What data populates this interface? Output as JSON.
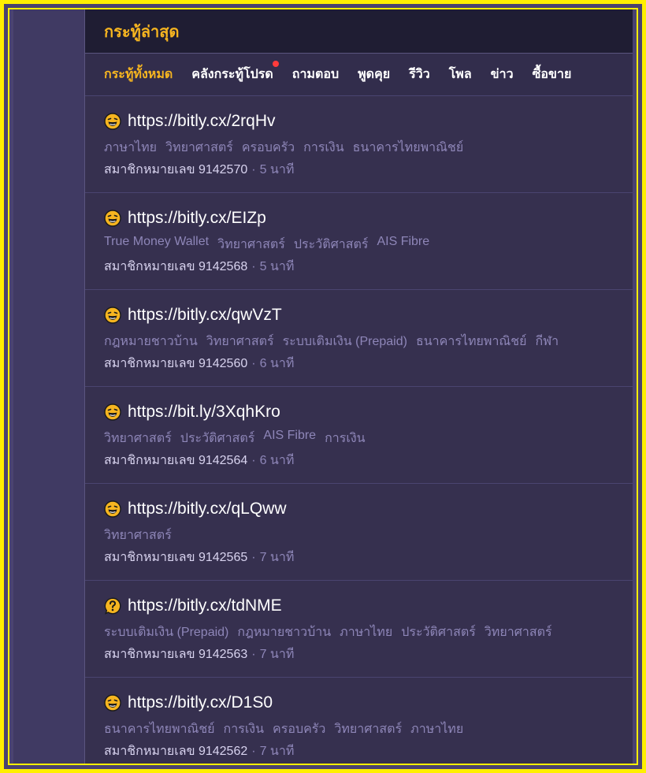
{
  "header": {
    "title": "กระทู้ล่าสุด"
  },
  "tabs": [
    {
      "label": "กระทู้ทั้งหมด",
      "active": true,
      "dot": false
    },
    {
      "label": "คลังกระทู้โปรด",
      "active": false,
      "dot": true
    },
    {
      "label": "ถามตอบ",
      "active": false,
      "dot": false
    },
    {
      "label": "พูดคุย",
      "active": false,
      "dot": false
    },
    {
      "label": "รีวิว",
      "active": false,
      "dot": false
    },
    {
      "label": "โพล",
      "active": false,
      "dot": false
    },
    {
      "label": "ข่าว",
      "active": false,
      "dot": false
    },
    {
      "label": "ซื้อขาย",
      "active": false,
      "dot": false
    }
  ],
  "colors": {
    "accent": "#f6b520",
    "notification_dot": "#ff3b3b",
    "frame": "#ffef00"
  },
  "topics": [
    {
      "icon": "laughing-face-icon",
      "title": "https://bitly.cx/2rqHv",
      "tags": [
        "ภาษาไทย",
        "วิทยาศาสตร์",
        "ครอบครัว",
        "การเงิน",
        "ธนาคารไทยพาณิชย์"
      ],
      "author": "สมาชิกหมายเลข 9142570",
      "time": "5 นาที"
    },
    {
      "icon": "laughing-face-icon",
      "title": "https://bitly.cx/EIZp",
      "tags": [
        "True Money Wallet",
        "วิทยาศาสตร์",
        "ประวัติศาสตร์",
        "AIS Fibre"
      ],
      "author": "สมาชิกหมายเลข 9142568",
      "time": "5 นาที"
    },
    {
      "icon": "laughing-face-icon",
      "title": "https://bitly.cx/qwVzT",
      "tags": [
        "กฎหมายชาวบ้าน",
        "วิทยาศาสตร์",
        "ระบบเติมเงิน (Prepaid)",
        "ธนาคารไทยพาณิชย์",
        "กีฬา"
      ],
      "author": "สมาชิกหมายเลข 9142560",
      "time": "6 นาที"
    },
    {
      "icon": "laughing-face-icon",
      "title": "https://bit.ly/3XqhKro",
      "tags": [
        "วิทยาศาสตร์",
        "ประวัติศาสตร์",
        "AIS Fibre",
        "การเงิน"
      ],
      "author": "สมาชิกหมายเลข 9142564",
      "time": "6 นาที"
    },
    {
      "icon": "laughing-face-icon",
      "title": "https://bitly.cx/qLQww",
      "tags": [
        "วิทยาศาสตร์"
      ],
      "author": "สมาชิกหมายเลข 9142565",
      "time": "7 นาที"
    },
    {
      "icon": "question-bubble-icon",
      "title": "https://bitly.cx/tdNME",
      "tags": [
        "ระบบเติมเงิน (Prepaid)",
        "กฎหมายชาวบ้าน",
        "ภาษาไทย",
        "ประวัติศาสตร์",
        "วิทยาศาสตร์"
      ],
      "author": "สมาชิกหมายเลข 9142563",
      "time": "7 นาที"
    },
    {
      "icon": "laughing-face-icon",
      "title": "https://bitly.cx/D1S0",
      "tags": [
        "ธนาคารไทยพาณิชย์",
        "การเงิน",
        "ครอบครัว",
        "วิทยาศาสตร์",
        "ภาษาไทย"
      ],
      "author": "สมาชิกหมายเลข 9142562",
      "time": "7 นาที"
    }
  ]
}
